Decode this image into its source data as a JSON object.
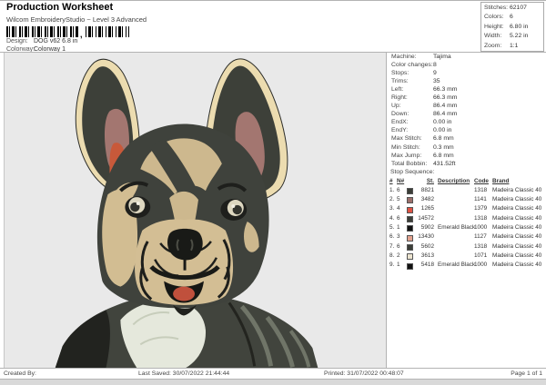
{
  "header": {
    "title": "Production Worksheet",
    "subtitle": "Wilcom EmbroideryStudio ~ Level 3 Advanced",
    "design_label": "Design:",
    "design_value": "DOG v62 6.8 in",
    "colorway_label": "Colorway:",
    "colorway_value": "Colorway 1",
    "barcode_comma": ","
  },
  "stats_box": {
    "rows": [
      {
        "label": "Stitches:",
        "value": "62107"
      },
      {
        "label": "Colors:",
        "value": "6"
      },
      {
        "label": "Height:",
        "value": "6.80 in"
      },
      {
        "label": "Width:",
        "value": "5.22 in"
      },
      {
        "label": "Zoom:",
        "value": "1:1"
      }
    ]
  },
  "machine_info": {
    "rows": [
      {
        "label": "Machine:",
        "value": "Tajima"
      },
      {
        "label": "Color changes:",
        "value": "8"
      },
      {
        "label": "Stops:",
        "value": "9"
      },
      {
        "label": "Trims:",
        "value": "35"
      },
      {
        "label": "Left:",
        "value": "66.3 mm"
      },
      {
        "label": "Right:",
        "value": "66.3 mm"
      },
      {
        "label": "Up:",
        "value": "86.4 mm"
      },
      {
        "label": "Down:",
        "value": "86.4 mm"
      },
      {
        "label": "EndX:",
        "value": "0.00 in"
      },
      {
        "label": "EndY:",
        "value": "0.00 in"
      },
      {
        "label": "Max Stitch:",
        "value": "6.8 mm"
      },
      {
        "label": "Min Stitch:",
        "value": "0.3 mm"
      },
      {
        "label": "Max Jump:",
        "value": "6.8 mm"
      },
      {
        "label": "Total Bobbin:",
        "value": "431.52ft"
      }
    ]
  },
  "stop_sequence": {
    "title": "Stop Sequence:",
    "columns": [
      "#",
      "N#",
      "St.",
      "Description",
      "Code",
      "Brand"
    ],
    "rows": [
      {
        "num": "1.",
        "n": "6",
        "color": "#3b3e38",
        "st": "8821",
        "description": "",
        "code": "1318",
        "brand": "Madeira Classic 40"
      },
      {
        "num": "2.",
        "n": "5",
        "color": "#9b6f6b",
        "st": "3482",
        "description": "",
        "code": "1141",
        "brand": "Madeira Classic 40"
      },
      {
        "num": "3.",
        "n": "4",
        "color": "#df5243",
        "st": "1265",
        "description": "",
        "code": "1379",
        "brand": "Madeira Classic 40"
      },
      {
        "num": "4.",
        "n": "6",
        "color": "#3b3e38",
        "st": "14572",
        "description": "",
        "code": "1318",
        "brand": "Madeira Classic 40"
      },
      {
        "num": "5.",
        "n": "1",
        "color": "#121212",
        "st": "5902",
        "description": "Emerald Black",
        "code": "1000",
        "brand": "Madeira Classic 40"
      },
      {
        "num": "6.",
        "n": "3",
        "color": "#e2a28f",
        "st": "13430",
        "description": "",
        "code": "1127",
        "brand": "Madeira Classic 40"
      },
      {
        "num": "7.",
        "n": "6",
        "color": "#3b3e38",
        "st": "5602",
        "description": "",
        "code": "1318",
        "brand": "Madeira Classic 40"
      },
      {
        "num": "8.",
        "n": "2",
        "color": "#ece4d0",
        "st": "3613",
        "description": "",
        "code": "1071",
        "brand": "Madeira Classic 40"
      },
      {
        "num": "9.",
        "n": "1",
        "color": "#121212",
        "st": "5418",
        "description": "Emerald Black",
        "code": "1000",
        "brand": "Madeira Classic 40"
      }
    ]
  },
  "design_area": {
    "background": "#e9e9e9",
    "artwork": "french-bulldog-embroidery-preview"
  },
  "footer": {
    "created_by": "Created By:",
    "last_saved": "Last Saved: 30/07/2022 21:44:44",
    "printed": "Printed: 31/07/2022 00:48:07",
    "page": "Page 1 of 1"
  }
}
